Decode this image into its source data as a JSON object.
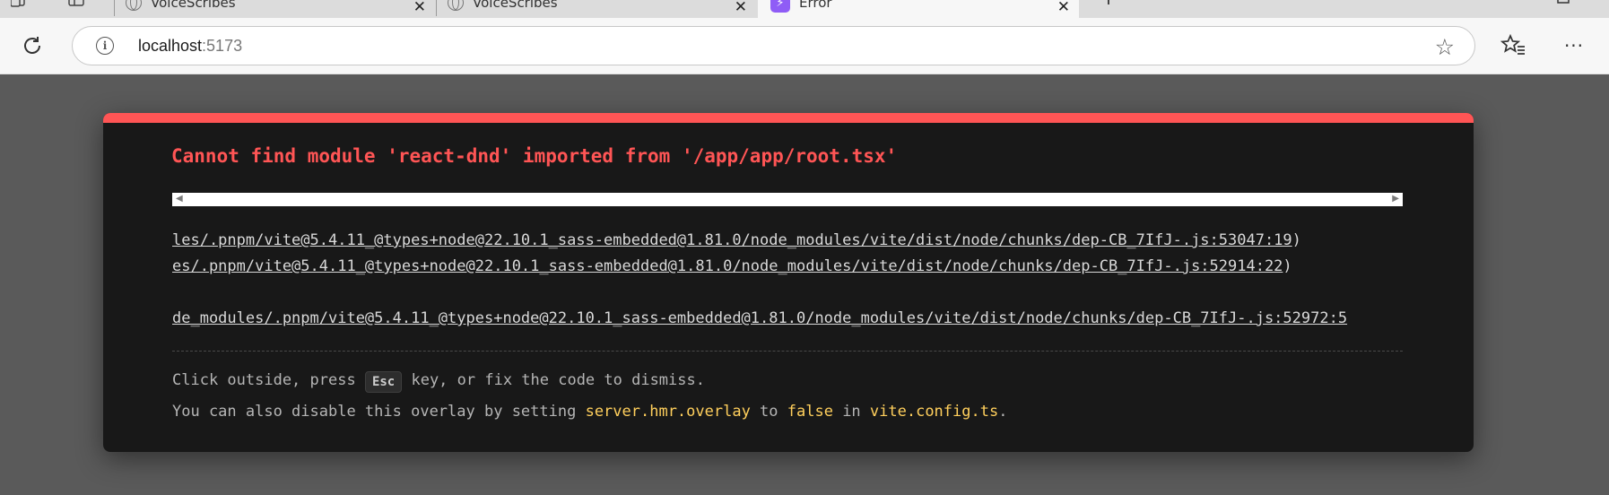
{
  "browser": {
    "tabs": [
      {
        "title": "VoiceScribes",
        "active": false
      },
      {
        "title": "VoiceScribes",
        "active": false
      },
      {
        "title": "Error",
        "active": true
      }
    ],
    "address": {
      "host": "localhost",
      "port": ":5173"
    }
  },
  "overlay": {
    "accent_color": "#ff5555",
    "message": "Cannot find module 'react-dnd' imported from '/app/app/root.tsx'",
    "stack": [
      {
        "link": "les/.pnpm/vite@5.4.11_@types+node@22.10.1_sass-embedded@1.81.0/node_modules/vite/dist/node/chunks/dep-CB_7IfJ-.js:53047:19",
        "suffix": ")"
      },
      {
        "link": "es/.pnpm/vite@5.4.11_@types+node@22.10.1_sass-embedded@1.81.0/node_modules/vite/dist/node/chunks/dep-CB_7IfJ-.js:52914:22",
        "suffix": ")"
      },
      {
        "link": "de_modules/.pnpm/vite@5.4.11_@types+node@22.10.1_sass-embedded@1.81.0/node_modules/vite/dist/node/chunks/dep-CB_7IfJ-.js:52972:5",
        "suffix": ""
      }
    ],
    "tip1": {
      "before": "Click outside, press ",
      "key": "Esc",
      "after": " key, or fix the code to dismiss."
    },
    "tip2": {
      "before": "You can also disable this overlay by setting ",
      "setting": "server.hmr.overlay",
      "middle1": " to ",
      "value": "false",
      "middle2": " in ",
      "file": "vite.config.ts",
      "end": "."
    }
  }
}
